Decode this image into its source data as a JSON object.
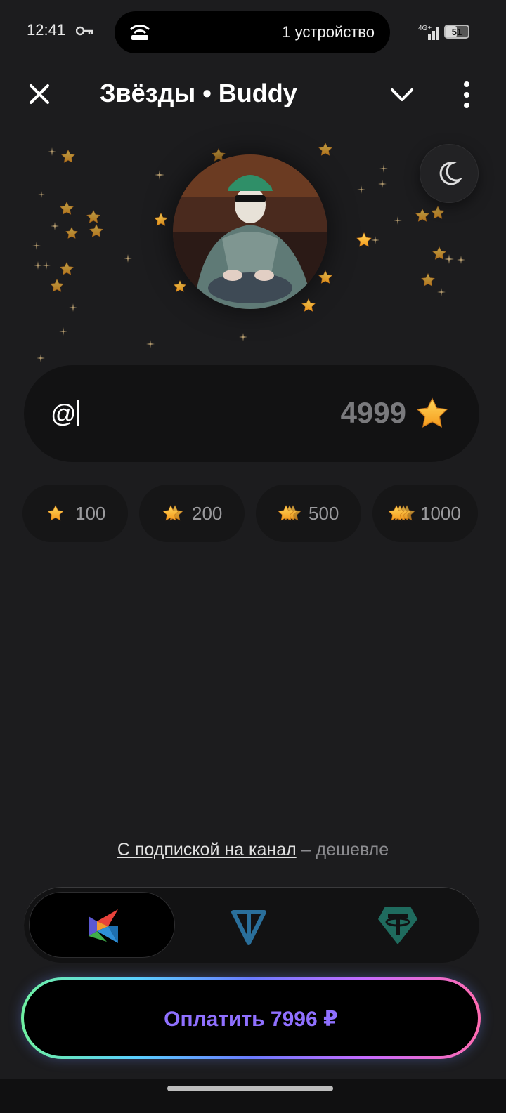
{
  "status_bar": {
    "time": "12:41",
    "hotspot_text": "1 устройство",
    "network": "4G+",
    "battery": "51",
    "battery_level": 0.51
  },
  "header": {
    "title": "Звёзды • Buddy"
  },
  "recipient_input": {
    "value": "@",
    "amount": "4999"
  },
  "quick_amounts": [
    {
      "label": "100"
    },
    {
      "label": "200"
    },
    {
      "label": "500"
    },
    {
      "label": "1000"
    }
  ],
  "subscription_hint": {
    "link": "С подпиской на канал",
    "suffix": " – дешевле"
  },
  "payment_methods": [
    {
      "icon": "sbp-icon",
      "selected": true
    },
    {
      "icon": "ton-icon",
      "selected": false
    },
    {
      "icon": "tether-icon",
      "selected": false
    }
  ],
  "pay_button": {
    "label": "Оплатить 7996 ₽"
  },
  "colors": {
    "background": "#1c1c1e",
    "star": "#f5b82e",
    "accent_gradient": [
      "#6ff0a0",
      "#5ad0ff",
      "#6a7bff",
      "#c66bff",
      "#ff6bb0"
    ],
    "ton": "#2a6f9b",
    "tether": "#1f6b5e"
  }
}
